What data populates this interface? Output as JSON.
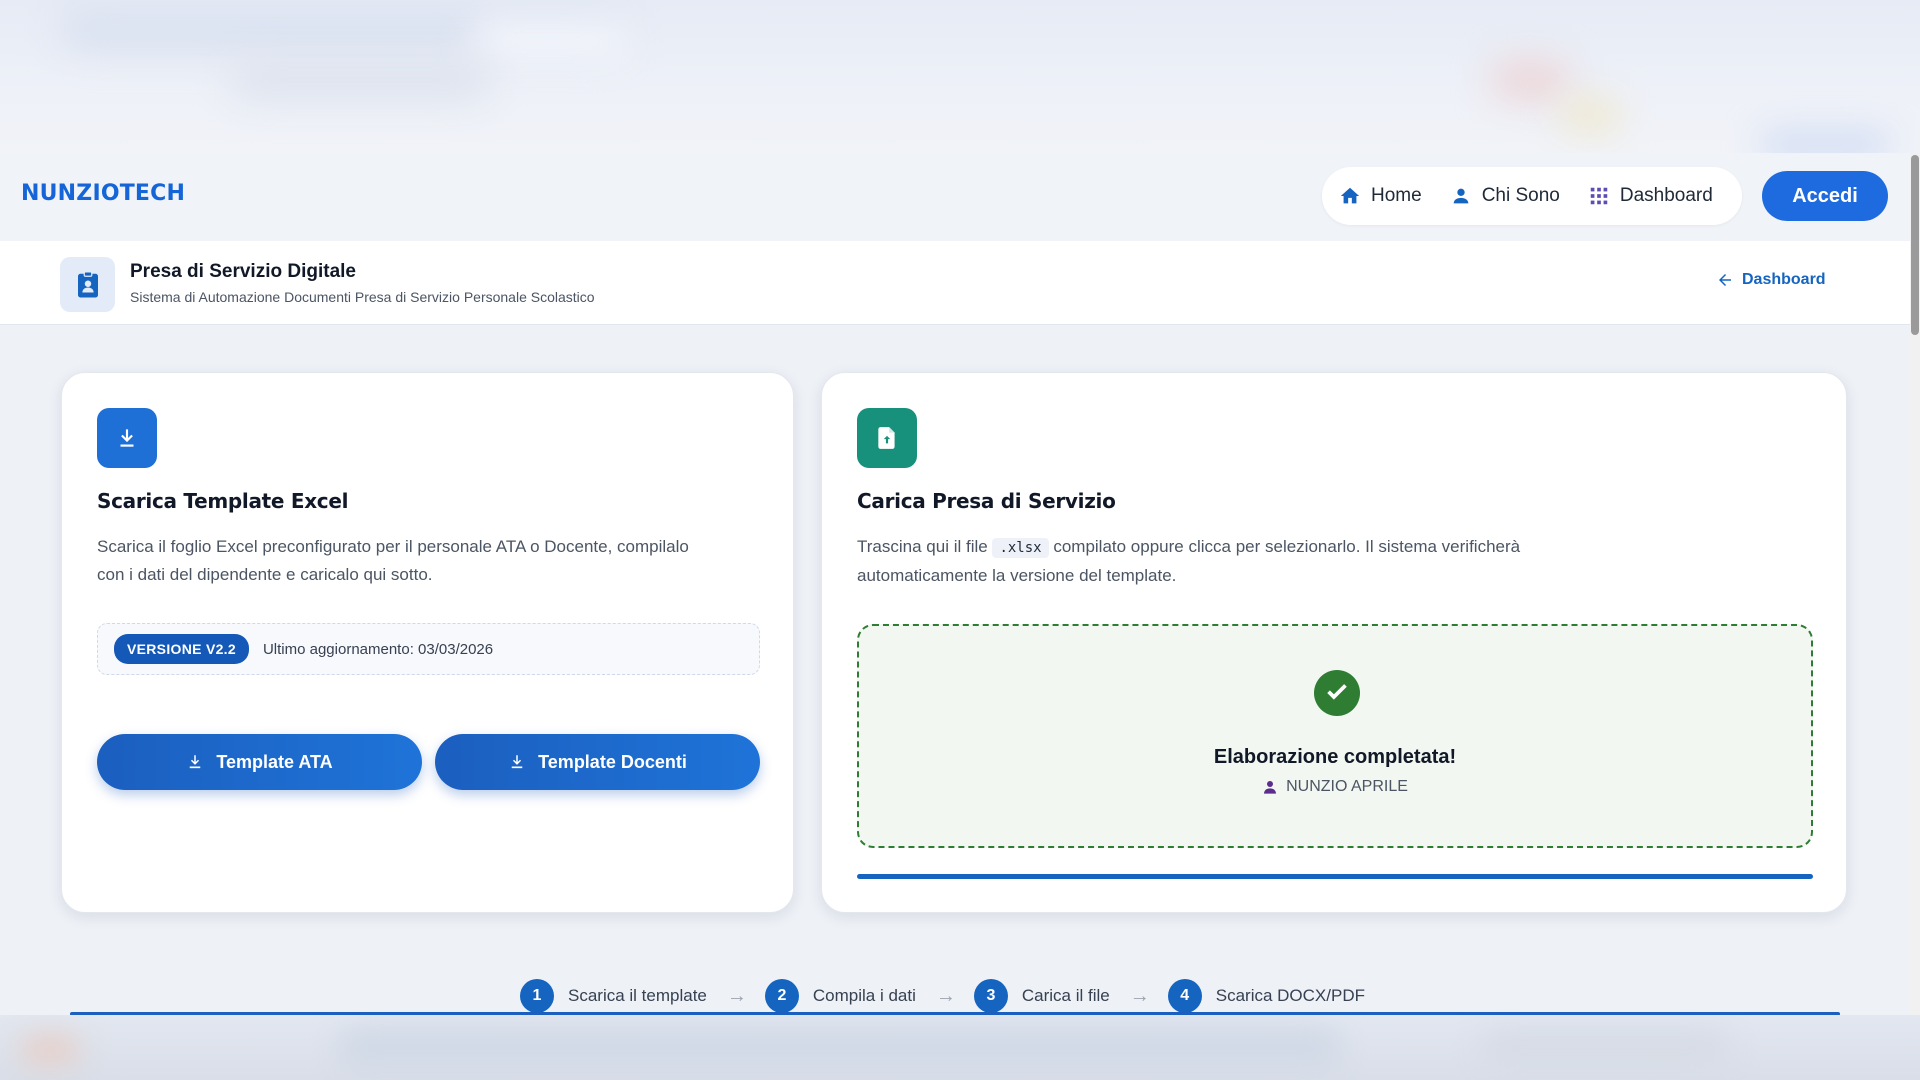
{
  "navbar": {
    "brand": "NUNZIOTECH",
    "items": [
      {
        "label": "Home",
        "icon": "home-icon"
      },
      {
        "label": "Chi Sono",
        "icon": "person-icon"
      },
      {
        "label": "Dashboard",
        "icon": "grid-icon"
      }
    ],
    "login_label": "Accedi"
  },
  "subheader": {
    "title": "Presa di Servizio Digitale",
    "description": "Sistema di Automazione Documenti Presa di Servizio Personale Scolastico",
    "back_label": "Dashboard"
  },
  "download_card": {
    "title": "Scarica Template Excel",
    "text_line1": "Scarica il foglio Excel preconfigurato per il personale ATA o Docente, compilalo",
    "text_line2": "con i dati del dipendente e caricalo qui sotto.",
    "version_badge": "VERSIONE V2.2",
    "version_date": "Ultimo aggiornamento: 03/03/2026",
    "button_ata": "Template ATA",
    "button_docenti": "Template Docenti"
  },
  "upload_card": {
    "title": "Carica Presa di Servizio",
    "text_before_code": "Trascina qui il file",
    "code": ".xlsx",
    "text_after_code": "compilato oppure clicca per selezionarlo. Il sistema verificherà",
    "text_line2": "automaticamente la versione del template.",
    "status_title": "Elaborazione completata!",
    "status_user": "NUNZIO APRILE",
    "progress": 1.0
  },
  "steps": [
    {
      "num": "1",
      "label": "Scarica il template"
    },
    {
      "num": "2",
      "label": "Compila i dati"
    },
    {
      "num": "3",
      "label": "Carica il file"
    },
    {
      "num": "4",
      "label": "Scarica DOCX/PDF"
    }
  ],
  "colors": {
    "primary": "#1565c0",
    "accent": "#1e6be0",
    "success": "#2e7d32",
    "teal": "#17907c"
  }
}
